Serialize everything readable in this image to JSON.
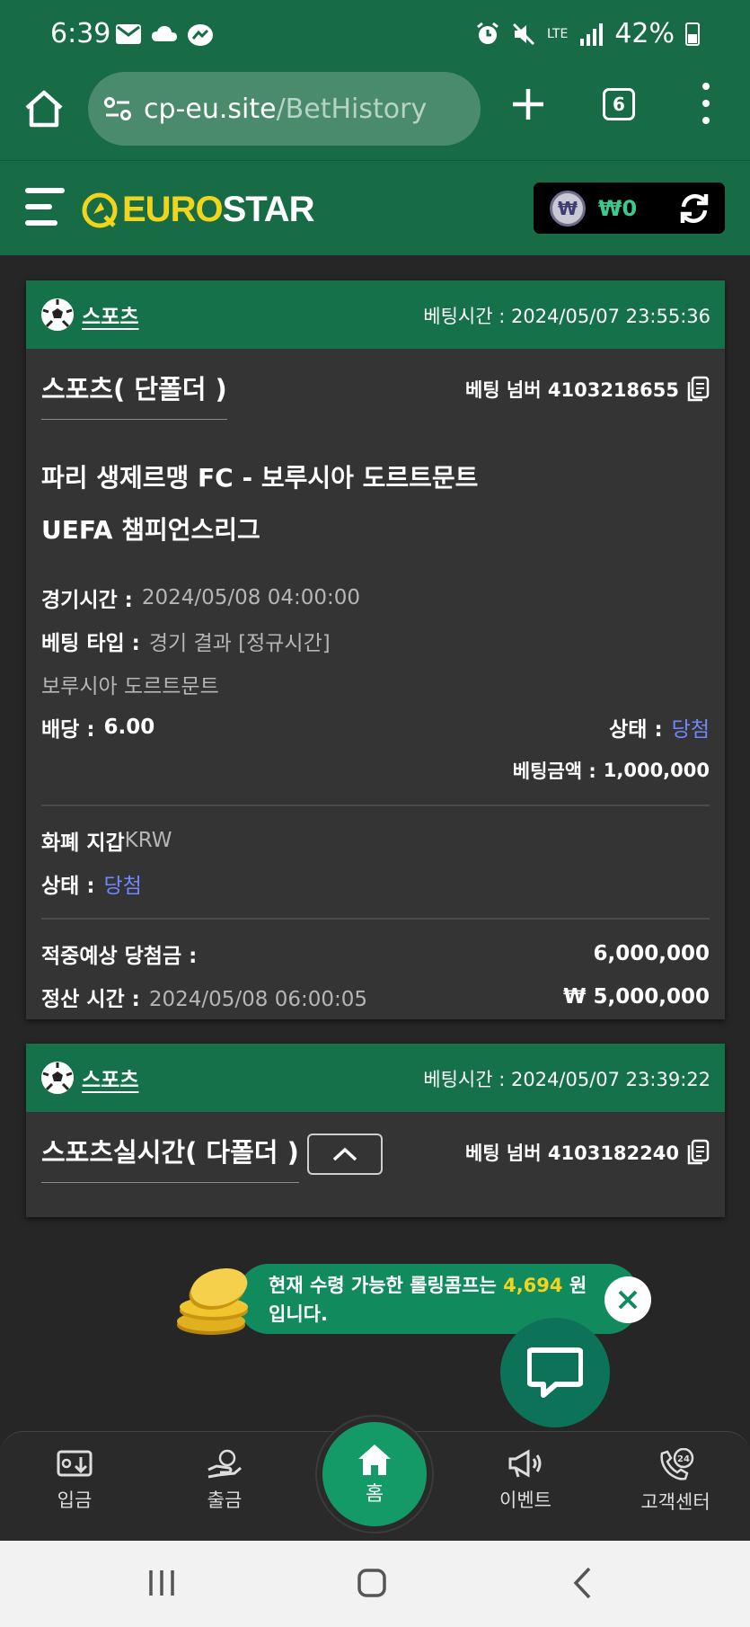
{
  "status_bar": {
    "time": "6:39",
    "network": "LTE",
    "battery": "42%"
  },
  "browser": {
    "url_host": "cp-eu.site",
    "url_path": "/BetHistory",
    "tab_count": "6"
  },
  "header": {
    "logo_euro": "EURO",
    "logo_star": "STAR",
    "coin_symbol": "₩",
    "wallet_balance": "₩0"
  },
  "bets": [
    {
      "sport_label": "스포츠",
      "bet_time": "베팅시간 : 2024/05/07 23:55:36",
      "bet_type": "스포츠( 단폴더 )",
      "bet_number": "베팅 넘버 4103218655",
      "match_line1": "파리 생제르맹 FC - 보루시아 도르트문트",
      "match_line2": "UEFA 챔피언스리그",
      "game_time_label": "경기시간 :",
      "game_time_value": "2024/05/08 04:00:00",
      "bet_kind_label": "베팅 타입 :",
      "bet_kind_value": "경기 결과 [정규시간]",
      "selection": "보루시아 도르트문트",
      "odds_label": "배당 :",
      "odds_value": "6.00",
      "status_label": "상태 :",
      "status_value": "당첨",
      "amount_label": "베팅금액 :",
      "amount_value": "1,000,000",
      "wallet_label": "화폐 지갑",
      "wallet_value": "KRW",
      "wallet_status_label": "상태 :",
      "wallet_status_value": "당첨",
      "expected_label": "적중예상 당첨금 :",
      "expected_value": "6,000,000",
      "settle_label": "정산 시간 :",
      "settle_value": "2024/05/08 06:00:05",
      "settle_amount": "₩ 5,000,000"
    },
    {
      "sport_label": "스포츠",
      "bet_time": "베팅시간 : 2024/05/07 23:39:22",
      "bet_type": "스포츠실시간( 다폴더 )",
      "bet_number": "베팅 넘버 4103182240"
    }
  ],
  "promo": {
    "text_before": "현재 수령 가능한 롤링콤프는 ",
    "amount": "4,694",
    "text_after": " 원",
    "line2": "입니다."
  },
  "bottom_nav": {
    "deposit": "입금",
    "withdraw": "출금",
    "home": "홈",
    "event": "이벤트",
    "support": "고객센터",
    "support_badge": "24"
  },
  "colors": {
    "brand_green": "#176b45",
    "card_head": "#14714a",
    "accent_yellow": "#f1d51d",
    "status_blue": "#6f87ff"
  }
}
